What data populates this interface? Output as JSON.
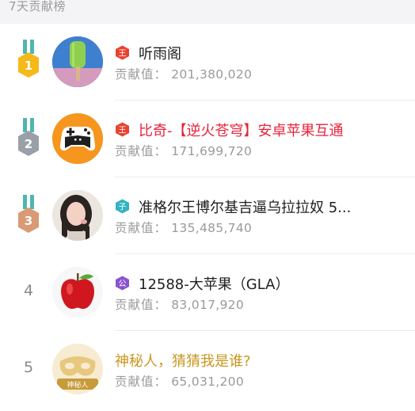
{
  "header": {
    "title": "7天贡献榜"
  },
  "contribution_label": "贡献值：",
  "rows": [
    {
      "rank": "1",
      "medal_text": "1",
      "name": "听雨阁",
      "value": "201,380,020",
      "avatar": "popsicle-avatar",
      "badge": "王"
    },
    {
      "rank": "2",
      "medal_text": "2",
      "name": "比奇-【逆火苍穹】安卓苹果互通",
      "value": "171,699,720",
      "avatar": "gamepad-avatar",
      "badge": "王"
    },
    {
      "rank": "3",
      "medal_text": "3",
      "name": "准格尔王博尔基吉逼乌拉拉奴 5...",
      "value": "135,485,740",
      "avatar": "girl-photo-avatar",
      "badge": "子"
    },
    {
      "rank": "4",
      "name": "12588-大苹果（GLA）",
      "value": "83,017,920",
      "avatar": "apple-avatar",
      "badge": "公"
    },
    {
      "rank": "5",
      "name": "神秘人，猜猜我是谁?",
      "value": "65,031,200",
      "avatar": "mask-avatar",
      "avatar_label": "神秘人"
    }
  ],
  "colors": {
    "gold": "#f5b91a",
    "silver": "#9aa0a8",
    "bronze": "#d99a74",
    "ribbon_teal": "#4fb6b0",
    "badge_red": "#e9432f",
    "badge_teal": "#34b2c2",
    "badge_purple": "#8a52d1",
    "name_red": "#e8233a",
    "mystery_gold": "#c9971f"
  }
}
